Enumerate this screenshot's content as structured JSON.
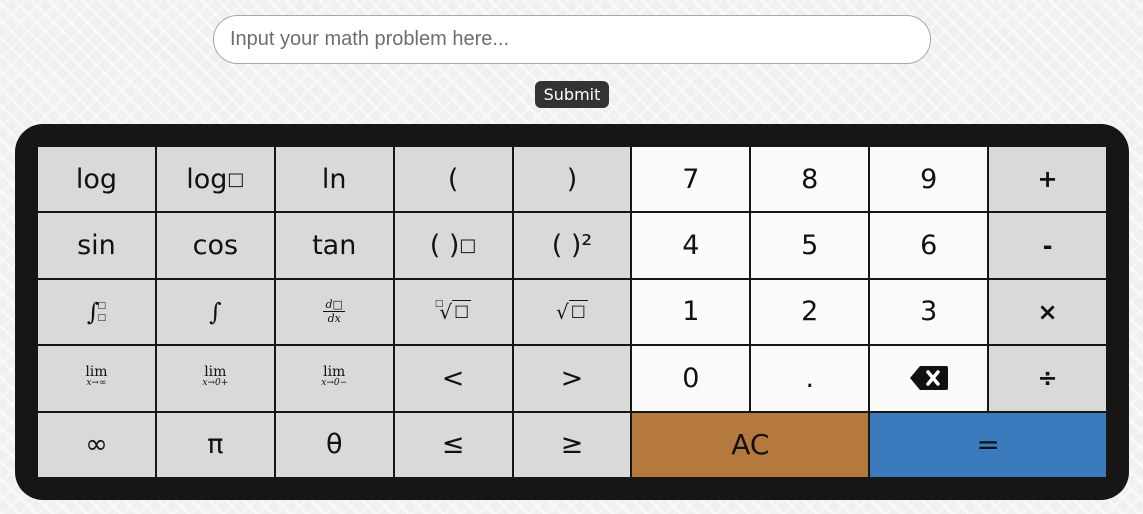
{
  "search": {
    "placeholder": "Input your math problem here...",
    "value": ""
  },
  "submit_label": "Submit",
  "keys": {
    "log": "log",
    "log_base": "log",
    "log_box": "□",
    "ln": "ln",
    "lparen": "(",
    "rparen": ")",
    "seven": "7",
    "eight": "8",
    "nine": "9",
    "plus": "+",
    "sin": "sin",
    "cos": "cos",
    "tan": "tan",
    "power_paren": "( )",
    "power_box": "□",
    "square": "( )²",
    "four": "4",
    "five": "5",
    "six": "6",
    "minus": "-",
    "def_integral_sign": "∫",
    "def_integral_upper": "□",
    "def_integral_lower": "□",
    "integral": "∫",
    "deriv_num": "d□",
    "deriv_den": "dx",
    "nth_root_index": "□",
    "nth_root_sign": "√",
    "nth_root_box": "□",
    "sqrt_sign": "√",
    "sqrt_box": "□",
    "one": "1",
    "two": "2",
    "three": "3",
    "times": "×",
    "lim_word": "lim",
    "lim_inf_sub": "x→∞",
    "lim_right_sub": "x→0+",
    "lim_left_sub": "x→0−",
    "less": "<",
    "greater": ">",
    "zero": "0",
    "dot": ".",
    "divide": "÷",
    "infinity": "∞",
    "pi": "π",
    "theta": "θ",
    "leq": "≤",
    "geq": "≥",
    "ac": "AC",
    "equals": "="
  },
  "colors": {
    "ac": "#b5793e",
    "equals": "#3a7abd",
    "function_key": "#d9d9d9",
    "number_key": "#fafafa",
    "pad": "#161616"
  },
  "icons": {
    "backspace": "backspace-icon"
  }
}
